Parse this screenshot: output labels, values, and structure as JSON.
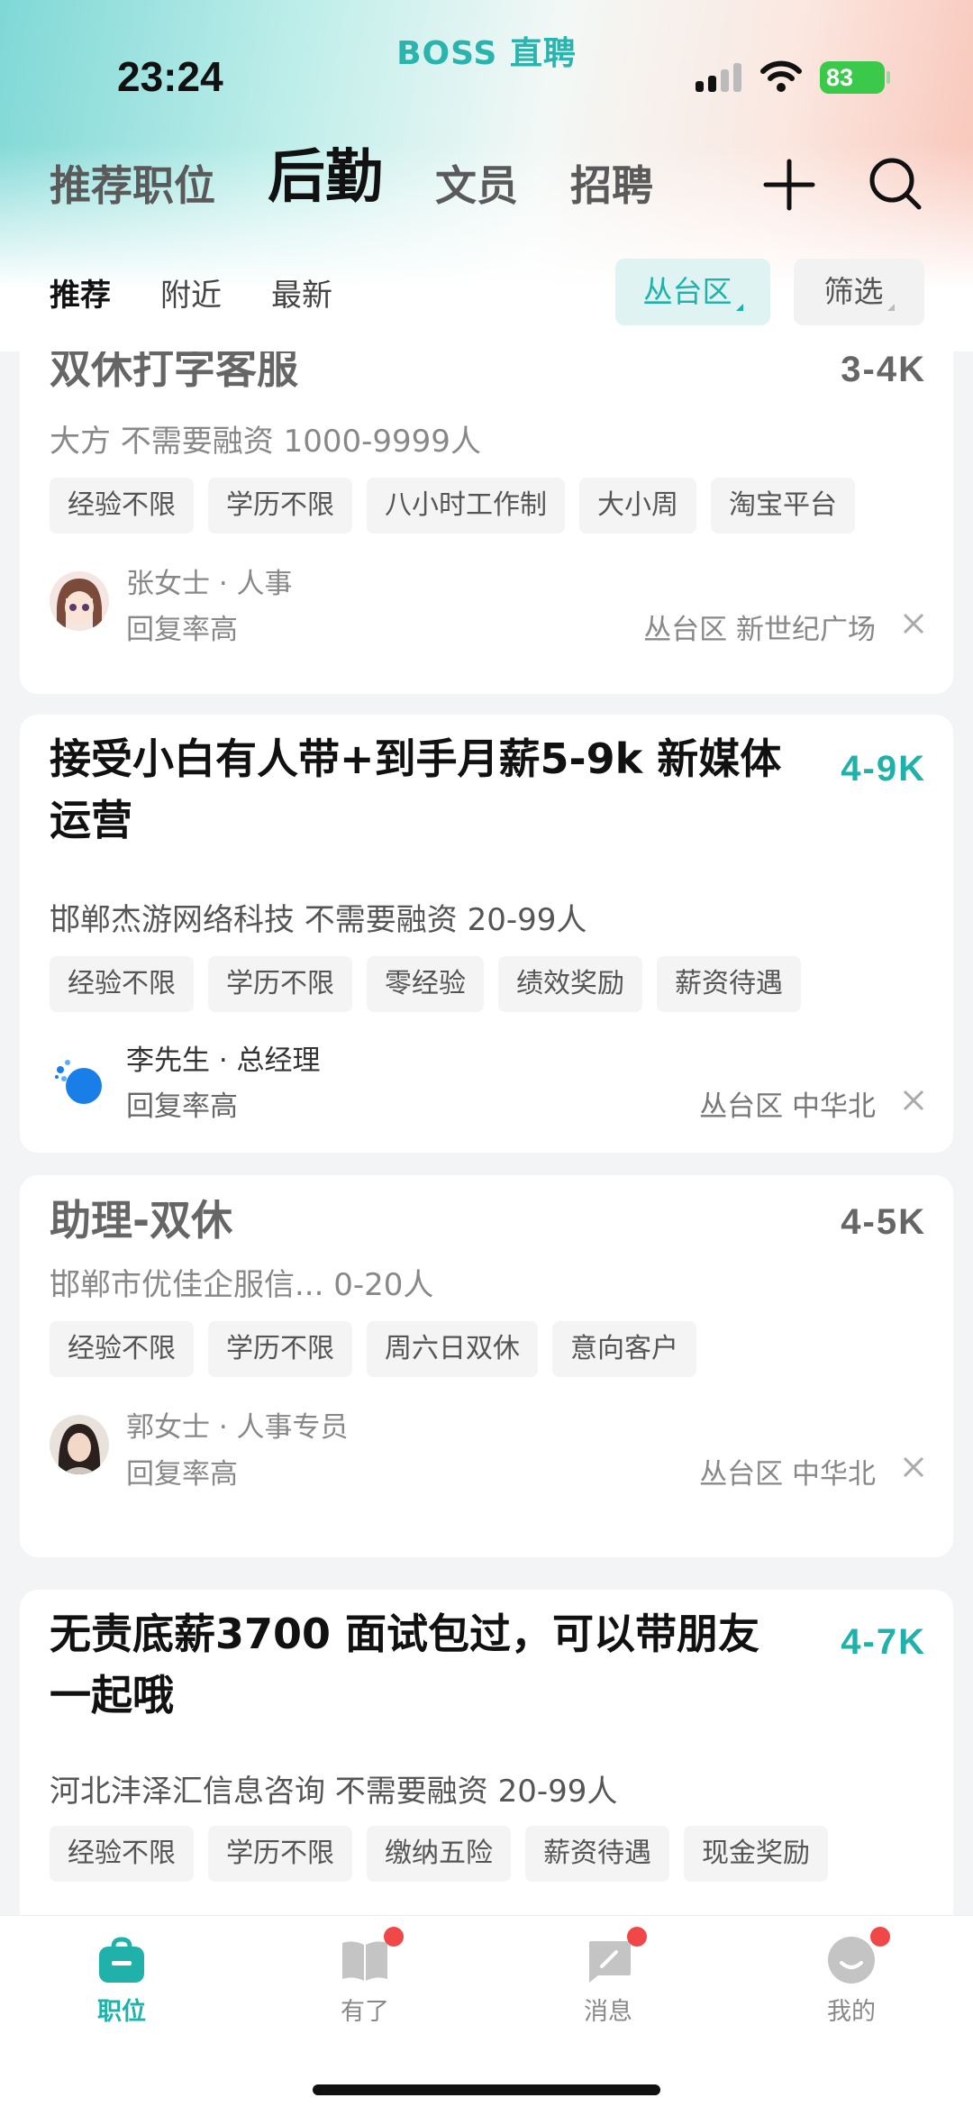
{
  "app": {
    "title": "BOSS 直聘"
  },
  "status_bar": {
    "time": "23:24",
    "battery": "83"
  },
  "top_tabs": [
    "推荐职位",
    "后勤",
    "文员",
    "招聘"
  ],
  "sub_tabs": [
    "推荐",
    "附近",
    "最新"
  ],
  "filters": {
    "district": "丛台区",
    "filter": "筛选"
  },
  "jobs": [
    {
      "title": "双休打字客服",
      "salary": "3-4K",
      "company": "大方 不需要融资 1000-9999人",
      "tags": [
        "经验不限",
        "学历不限",
        "八小时工作制",
        "大小周",
        "淘宝平台"
      ],
      "recruiter": "张女士 · 人事",
      "reply": "回复率高",
      "location": "丛台区 新世纪广场"
    },
    {
      "title_line1": "接受小白有人带+到手月薪5-9k 新媒体",
      "title_line2": "运营",
      "salary": "4-9K",
      "company": "邯郸杰游网络科技 不需要融资 20-99人",
      "tags": [
        "经验不限",
        "学历不限",
        "零经验",
        "绩效奖励",
        "薪资待遇"
      ],
      "recruiter": "李先生 · 总经理",
      "reply": "回复率高",
      "location": "丛台区 中华北"
    },
    {
      "title": "助理-双休",
      "salary": "4-5K",
      "company": "邯郸市优佳企服信... 0-20人",
      "tags": [
        "经验不限",
        "学历不限",
        "周六日双休",
        "意向客户"
      ],
      "recruiter": "郭女士 · 人事专员",
      "reply": "回复率高",
      "location": "丛台区 中华北"
    },
    {
      "title_line1": "无责底薪3700 面试包过，可以带朋友",
      "title_line2": "一起哦",
      "salary": "4-7K",
      "company": "河北沣泽汇信息咨询 不需要融资 20-99人",
      "tags": [
        "经验不限",
        "学历不限",
        "缴纳五险",
        "薪资待遇",
        "现金奖励"
      ]
    }
  ],
  "bottom_nav": [
    "职位",
    "有了",
    "消息",
    "我的"
  ],
  "colors": {
    "accent": "#20b2aa",
    "badge": "#f04848"
  }
}
